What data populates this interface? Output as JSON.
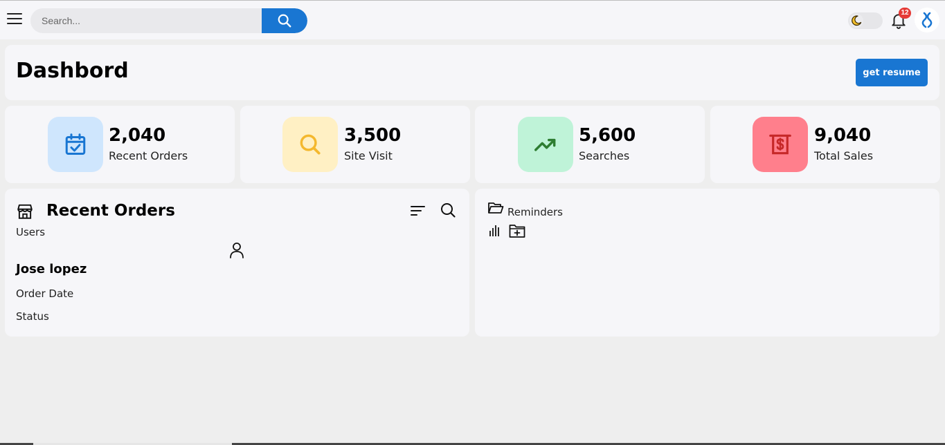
{
  "topbar": {
    "search": {
      "placeholder": "Search...",
      "value": ""
    },
    "theme_icon": "moon-icon",
    "notification_count": "12",
    "colors": {
      "accent": "#1976d2",
      "badge": "#e53935"
    }
  },
  "header": {
    "title": "Dashbord",
    "action_label": "get resume"
  },
  "stats": [
    {
      "value": "2,040",
      "label": "Recent Orders",
      "icon": "calendar-check-icon",
      "bg": "#cfe6fd",
      "fg": "#1976d2"
    },
    {
      "value": "3,500",
      "label": "Site Visit",
      "icon": "search-icon",
      "bg": "#fff0c4",
      "fg": "#f4b82e"
    },
    {
      "value": "5,600",
      "label": "Searches",
      "icon": "trending-up-icon",
      "bg": "#bff3d8",
      "fg": "#2e7d32"
    },
    {
      "value": "9,040",
      "label": "Total Sales",
      "icon": "receipt-dollar-icon",
      "bg": "#ff7f8c",
      "fg": "#c62828"
    }
  ],
  "recent_orders": {
    "title": "Recent Orders",
    "users_label": "Users",
    "user_name": "Jose lopez",
    "order_date_label": "Order Date",
    "status_label": "Status"
  },
  "reminders": {
    "title": "Reminders"
  }
}
